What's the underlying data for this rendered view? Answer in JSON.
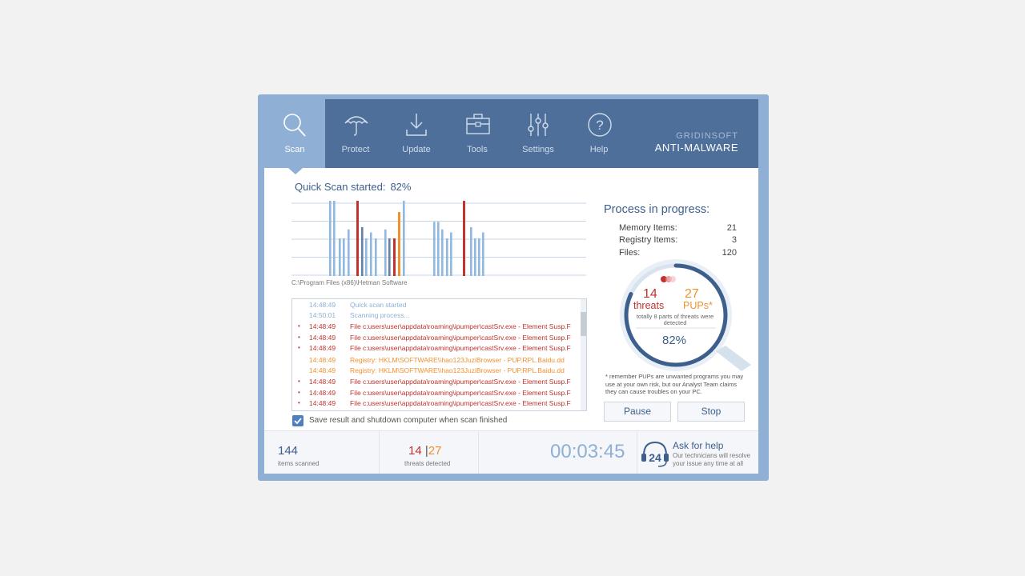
{
  "nav": {
    "items": [
      {
        "label": "Scan",
        "icon": "search-icon"
      },
      {
        "label": "Protect",
        "icon": "umbrella-icon"
      },
      {
        "label": "Update",
        "icon": "download-icon"
      },
      {
        "label": "Tools",
        "icon": "toolbox-icon"
      },
      {
        "label": "Settings",
        "icon": "sliders-icon"
      },
      {
        "label": "Help",
        "icon": "question-icon"
      }
    ],
    "active": "Scan",
    "brand_top": "GRIDINSOFT",
    "brand_bottom": "ANTI-MALWARE"
  },
  "scan": {
    "title": "Quick Scan started:",
    "percent": "82%",
    "current_path": "C:\\Program Files (x86)\\Hetman Software"
  },
  "chart_data": {
    "type": "bar",
    "colors": {
      "normal": "#8fb9e0",
      "dark": "#6481ac",
      "threat": "#c0332e",
      "pup": "#f0902e"
    },
    "bars": [
      {
        "v": 1.0,
        "k": "normal"
      },
      {
        "v": 1.0,
        "k": "normal"
      },
      {
        "v": 0.5,
        "k": "normal"
      },
      {
        "v": 0.5,
        "k": "normal"
      },
      {
        "v": 0.62,
        "k": "normal"
      },
      {
        "v": 1.0,
        "k": "threat"
      },
      {
        "v": 0.65,
        "k": "dark"
      },
      {
        "v": 0.5,
        "k": "normal"
      },
      {
        "v": 0.58,
        "k": "normal"
      },
      {
        "v": 0.5,
        "k": "normal"
      },
      {
        "v": 0.62,
        "k": "normal"
      },
      {
        "v": 0.5,
        "k": "dark"
      },
      {
        "v": 0.5,
        "k": "threat"
      },
      {
        "v": 0.85,
        "k": "pup"
      },
      {
        "v": 1.0,
        "k": "normal"
      },
      {
        "v": 0.72,
        "k": "normal"
      },
      {
        "v": 0.72,
        "k": "normal"
      },
      {
        "v": 0.62,
        "k": "normal"
      },
      {
        "v": 0.5,
        "k": "normal"
      },
      {
        "v": 0.58,
        "k": "normal"
      },
      {
        "v": 1.0,
        "k": "threat"
      },
      {
        "v": 0.65,
        "k": "normal"
      },
      {
        "v": 0.5,
        "k": "normal"
      },
      {
        "v": 0.5,
        "k": "normal"
      },
      {
        "v": 0.58,
        "k": "normal"
      }
    ],
    "gridlines": 4
  },
  "log": [
    {
      "time": "14:48:49",
      "msg": "Quick scan started",
      "type": "info",
      "dot": false
    },
    {
      "time": "14:50:01",
      "msg": "Scanning process...",
      "type": "info",
      "dot": false
    },
    {
      "time": "14:48:49",
      "msg": "File c:users\\user\\appdata\\roaming\\ipumper\\castSrv.exe - Element Susp.F",
      "type": "threat",
      "dot": true
    },
    {
      "time": "14:48:49",
      "msg": "File c:users\\user\\appdata\\roaming\\ipumper\\castSrv.exe - Element Susp.F",
      "type": "threat",
      "dot": true
    },
    {
      "time": "14:48:49",
      "msg": "File c:users\\user\\appdata\\roaming\\ipumper\\castSrv.exe - Element Susp.F",
      "type": "threat",
      "dot": true
    },
    {
      "time": "14:48:49",
      "msg": "Registry: HKLM\\SOFTWARE\\\\hao123JuziBrowser - PUP.RPL.Baidu.dd",
      "type": "pup",
      "dot": false
    },
    {
      "time": "14:48:49",
      "msg": "Registry: HKLM\\SOFTWARE\\\\hao123JuziBrowser - PUP.RPL.Baidu.dd",
      "type": "pup",
      "dot": false
    },
    {
      "time": "14:48:49",
      "msg": "File c:users\\user\\appdata\\roaming\\ipumper\\castSrv.exe - Element Susp.F",
      "type": "threat",
      "dot": true
    },
    {
      "time": "14:48:49",
      "msg": "File c:users\\user\\appdata\\roaming\\ipumper\\castSrv.exe - Element Susp.F",
      "type": "threat",
      "dot": true
    },
    {
      "time": "14:48:49",
      "msg": "File c:users\\user\\appdata\\roaming\\ipumper\\castSrv.exe - Element Susp.F",
      "type": "threat",
      "dot": true
    }
  ],
  "shutdown_checkbox": {
    "label": "Save result and shutdown computer when scan finished",
    "checked": true
  },
  "process": {
    "title": "Process in progress:",
    "stats": [
      {
        "label": "Memory Items:",
        "value": "21"
      },
      {
        "label": "Registry Items:",
        "value": "3"
      },
      {
        "label": "Files:",
        "value": "120"
      }
    ],
    "threats_count": "14",
    "threats_label": "threats",
    "pups_count": "27",
    "pups_label": "PUPs*",
    "detected_note": "totally 8 parts of threats were detected",
    "percent": "82%",
    "progress": 0.82,
    "pups_note": "* remember PUPs are unwanted programs you may use at your own risk, but our Analyst Team claims they can cause troubles on your PC."
  },
  "buttons": {
    "pause": "Pause",
    "stop": "Stop"
  },
  "footer": {
    "items_scanned": "144",
    "items_scanned_label": "items scanned",
    "threats_detected": "14",
    "pups_detected": "27",
    "separator": "|",
    "threats_detected_label": "threats detected",
    "elapsed": "00:03:45",
    "help_title": "Ask for help",
    "help_text": "Our technicians will resolve your issue any time at all",
    "help_badge": "24"
  }
}
